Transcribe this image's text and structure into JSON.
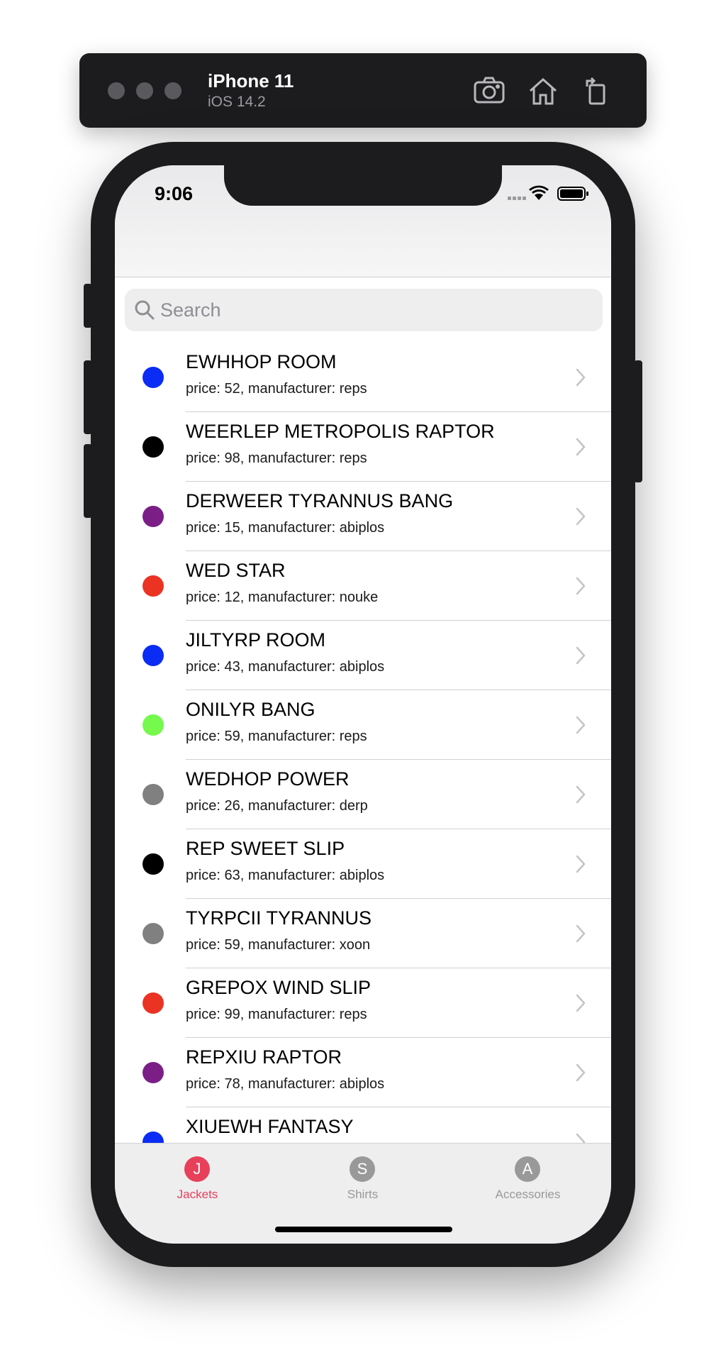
{
  "simulator": {
    "device_name": "iPhone 11",
    "os_version": "iOS 14.2",
    "buttons": [
      "screenshot-icon",
      "home-icon",
      "rotate-icon"
    ]
  },
  "status_bar": {
    "time": "9:06",
    "icons": [
      "cellular-signal-icon",
      "wifi-icon",
      "battery-icon"
    ]
  },
  "search": {
    "placeholder": "Search",
    "value": ""
  },
  "items": [
    {
      "title": "EWHHOP ROOM",
      "subtitle": "price: 52, manufacturer: reps",
      "color": "#0a2cf5"
    },
    {
      "title": "WEERLEP METROPOLIS RAPTOR",
      "subtitle": "price: 98, manufacturer: reps",
      "color": "#000000"
    },
    {
      "title": "DERWEER TYRANNUS BANG",
      "subtitle": "price: 15, manufacturer: abiplos",
      "color": "#7b1f87"
    },
    {
      "title": "WED STAR",
      "subtitle": "price: 12, manufacturer: nouke",
      "color": "#ea3323"
    },
    {
      "title": "JILTYRP ROOM",
      "subtitle": "price: 43, manufacturer: abiplos",
      "color": "#0a2cf5"
    },
    {
      "title": "ONILYR BANG",
      "subtitle": "price: 59, manufacturer: reps",
      "color": "#75f94c"
    },
    {
      "title": "WEDHOP POWER",
      "subtitle": "price: 26, manufacturer: derp",
      "color": "#808080"
    },
    {
      "title": "REP SWEET SLIP",
      "subtitle": "price: 63, manufacturer: abiplos",
      "color": "#000000"
    },
    {
      "title": "TYRPCII TYRANNUS",
      "subtitle": "price: 59, manufacturer: xoon",
      "color": "#808080"
    },
    {
      "title": "GREPOX WIND SLIP",
      "subtitle": "price: 99, manufacturer: reps",
      "color": "#ea3323"
    },
    {
      "title": "REPXIU RAPTOR",
      "subtitle": "price: 78, manufacturer: abiplos",
      "color": "#7b1f87"
    },
    {
      "title": "XIUEWH FANTASY",
      "subtitle": "",
      "color": "#0a2cf5"
    }
  ],
  "tabs": [
    {
      "letter": "J",
      "label": "Jackets",
      "selected": true
    },
    {
      "letter": "S",
      "label": "Shirts",
      "selected": false
    },
    {
      "letter": "A",
      "label": "Accessories",
      "selected": false
    }
  ],
  "colors": {
    "tab_selected": "#e8405a",
    "tab_unselected": "#999999"
  }
}
